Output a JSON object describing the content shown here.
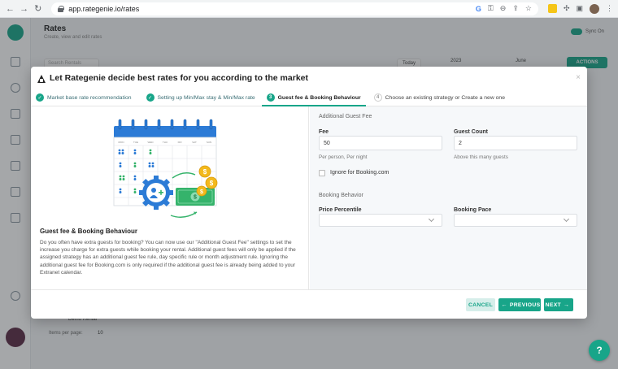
{
  "browser": {
    "url": "app.rategenie.io/rates"
  },
  "app": {
    "title": "Rates",
    "subtitle": "Create, view and edit rates",
    "sync_label": "Sync On",
    "search_placeholder": "Search Rentals",
    "today_label": "Today",
    "year": "2023",
    "month": "June",
    "actions_label": "ACTIONS",
    "row_name": "Demo Rental",
    "items_per_page_label": "Items per page:",
    "items_per_page_value": "10",
    "help_label": "?"
  },
  "modal": {
    "title": "Let Rategenie decide best rates for you according to the market",
    "close_label": "×",
    "steps": [
      {
        "label": "Market base rate recommendation",
        "state": "done"
      },
      {
        "label": "Setting up Min/Max stay & Min/Max rate",
        "state": "done"
      },
      {
        "number": "3",
        "label": "Guest fee & Booking Behaviour",
        "state": "active"
      },
      {
        "number": "4",
        "label": "Choose an existing strategy or Create a new one",
        "state": "pending"
      }
    ],
    "left": {
      "heading": "Guest fee & Booking Behaviour",
      "body": "Do you often have extra guests for booking? You can now use our \"Additional Guest Fee\" settings to set the increase you charge for extra guests while booking your rental. Additional guest fees will only be applied if the assigned strategy has an additional guest fee rule, day specific rule or month adjustment rule. Ignoring the additional guest fee for Booking.com is only required if the additional guest fee is already being added to your Extranet calendar.",
      "calendar_days": [
        "MON",
        "TUE",
        "WED",
        "THU",
        "FRI",
        "SAT",
        "SUN"
      ]
    },
    "right": {
      "additional_guest_fee_label": "Additional Guest Fee",
      "fee": {
        "label": "Fee",
        "value": "50",
        "help": "Per person, Per night"
      },
      "guest_count": {
        "label": "Guest Count",
        "value": "2",
        "help": "Above this many guests"
      },
      "ignore_booking_label": "Ignore for Booking.com",
      "ignore_booking_checked": false,
      "booking_behavior_label": "Booking Behavior",
      "price_percentile": {
        "label": "Price Percentile",
        "value": ""
      },
      "booking_pace": {
        "label": "Booking Pace",
        "value": ""
      }
    },
    "footer": {
      "cancel_label": "CANCEL",
      "previous_label": "PREVIOUS",
      "next_label": "NEXT"
    }
  },
  "colors": {
    "accent": "#18a589",
    "calendar_blue": "#2c7bd6",
    "money_green": "#35b36b",
    "coin_gold": "#f3b91c"
  }
}
